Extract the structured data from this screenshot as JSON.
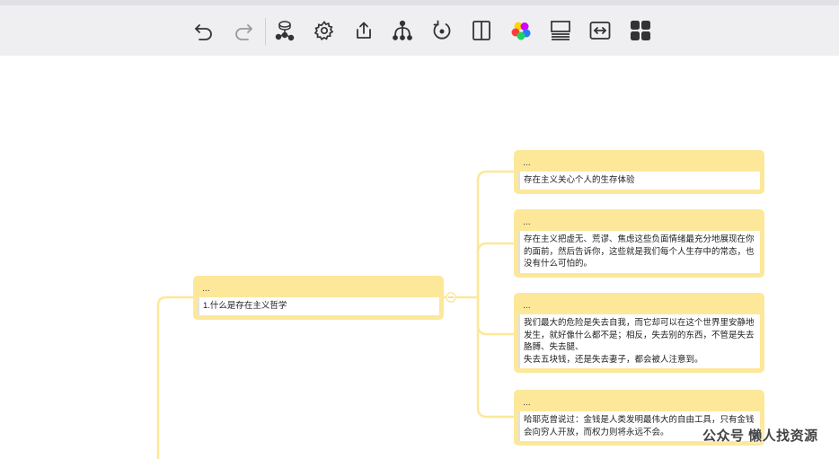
{
  "toolbar": {
    "buttons": [
      {
        "icon": "undo-icon"
      },
      {
        "icon": "redo-icon"
      },
      {
        "icon": "theme-icon"
      },
      {
        "icon": "settings-gear-icon"
      },
      {
        "icon": "export-share-icon"
      },
      {
        "icon": "structure-fork-icon"
      },
      {
        "icon": "reset-rotate-icon"
      },
      {
        "icon": "split-columns-icon"
      },
      {
        "icon": "color-palette-icon"
      },
      {
        "icon": "layout-lines-icon"
      },
      {
        "icon": "fit-width-icon"
      },
      {
        "icon": "apps-grid-icon"
      }
    ]
  },
  "colors": {
    "node_fill": "#fde899",
    "connector": "#fde899",
    "toolbar_bg": "#efeff2",
    "palette": [
      "#ff3b3b",
      "#ffd600",
      "#1fd35f",
      "#2979ff",
      "#d500f9"
    ]
  },
  "mindmap": {
    "topic": {
      "head": "...",
      "text": "1.什么是存在主义哲学"
    },
    "children": [
      {
        "head": "...",
        "text": "存在主义关心个人的生存体验"
      },
      {
        "head": "...",
        "text": "存在主义把虚无、荒谬、焦虑这些负面情绪最充分地展现在你的面前，然后告诉你，这些就是我们每个人生存中的常态，也没有什么可怕的。"
      },
      {
        "head": "...",
        "text": "我们最大的危险是失去自我，而它却可以在这个世界里安静地发生，就好像什么都不是；相反，失去别的东西，不管是失去胳膊、失去腿、\n失去五块钱，还是失去妻子，都会被人注意到。"
      },
      {
        "head": "...",
        "text": "哈耶克曾说过：金钱是人类发明最伟大的自由工具，只有金钱会向穷人开放，而权力则将永远不会。"
      }
    ]
  },
  "watermark": "公众号  懒人找资源"
}
